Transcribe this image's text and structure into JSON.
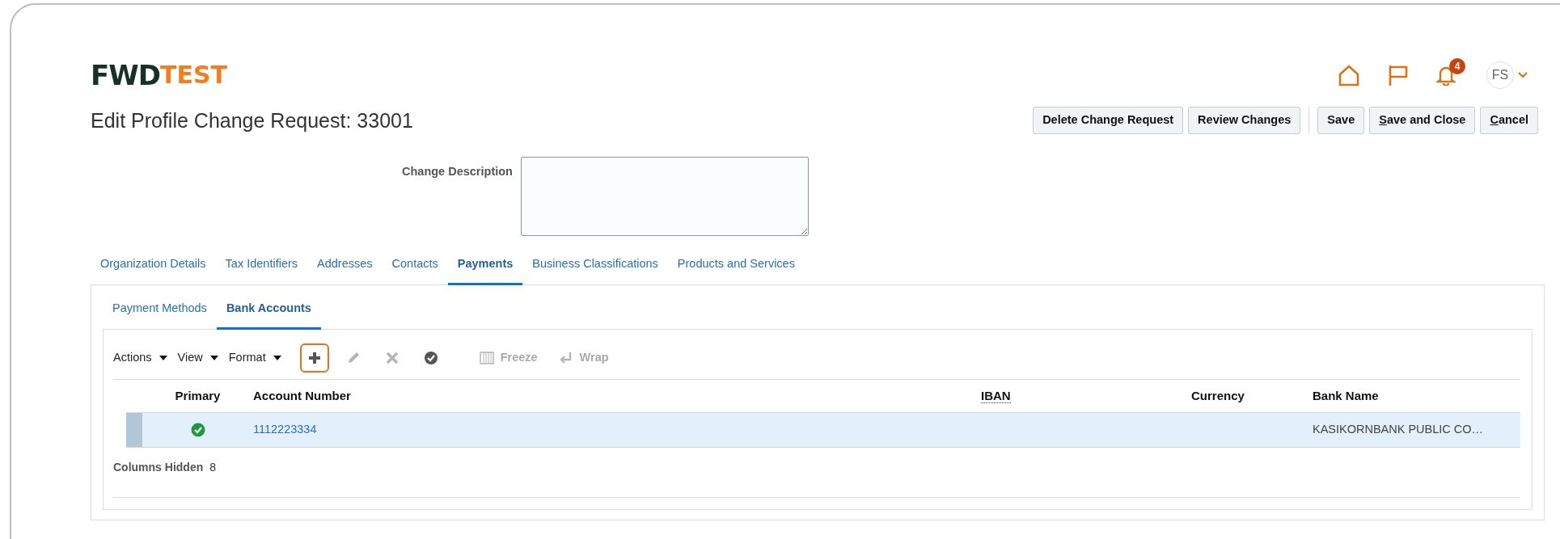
{
  "header": {
    "logo_main": "FWD",
    "logo_accent": "TEST",
    "notifications": "4",
    "avatar": "FS"
  },
  "title": "Edit Profile Change Request: 33001",
  "actions": [
    {
      "label": "Delete Change Request",
      "underline_first": false
    },
    {
      "label": "Review Changes",
      "underline_first": false
    },
    {
      "label": "Save",
      "underline_first": false
    },
    {
      "label": "Save and Close",
      "underline_first": true
    },
    {
      "label": "Cancel",
      "underline_first": true
    }
  ],
  "change_description": {
    "label": "Change Description"
  },
  "tabs": [
    {
      "label": "Organization Details",
      "selected": false
    },
    {
      "label": "Tax Identifiers",
      "selected": false
    },
    {
      "label": "Addresses",
      "selected": false
    },
    {
      "label": "Contacts",
      "selected": false
    },
    {
      "label": "Payments",
      "selected": true
    },
    {
      "label": "Business Classifications",
      "selected": false
    },
    {
      "label": "Products and Services",
      "selected": false
    }
  ],
  "subtabs": [
    {
      "label": "Payment Methods",
      "selected": false
    },
    {
      "label": "Bank Accounts",
      "selected": true
    }
  ],
  "toolbar": [
    {
      "kind": "menu",
      "label": "Actions",
      "disabled": false
    },
    {
      "kind": "menu",
      "label": "View",
      "disabled": false
    },
    {
      "kind": "menu",
      "label": "Format",
      "disabled": false
    },
    {
      "kind": "add",
      "disabled": false,
      "highlighted": true
    },
    {
      "kind": "edit",
      "disabled": true,
      "highlighted": false
    },
    {
      "kind": "delete",
      "disabled": true,
      "highlighted": false
    },
    {
      "kind": "check",
      "disabled": false,
      "highlighted": false
    },
    {
      "kind": "freeze",
      "label": "Freeze",
      "disabled": true
    },
    {
      "kind": "wrap",
      "label": "Wrap",
      "disabled": true
    }
  ],
  "table": {
    "columns": [
      {
        "label": "Primary",
        "dotted": false
      },
      {
        "label": "Account Number",
        "dotted": false
      },
      {
        "label": "IBAN",
        "dotted": true
      },
      {
        "label": "Currency",
        "dotted": false
      },
      {
        "label": "Bank Name",
        "dotted": false
      }
    ],
    "rows": [
      {
        "selected": true,
        "primary": true,
        "account_number": "1112223334",
        "bank_name": "KASIKORNBANK PUBLIC CO…"
      }
    ],
    "footer_label": "Columns Hidden",
    "footer_value": "8"
  }
}
